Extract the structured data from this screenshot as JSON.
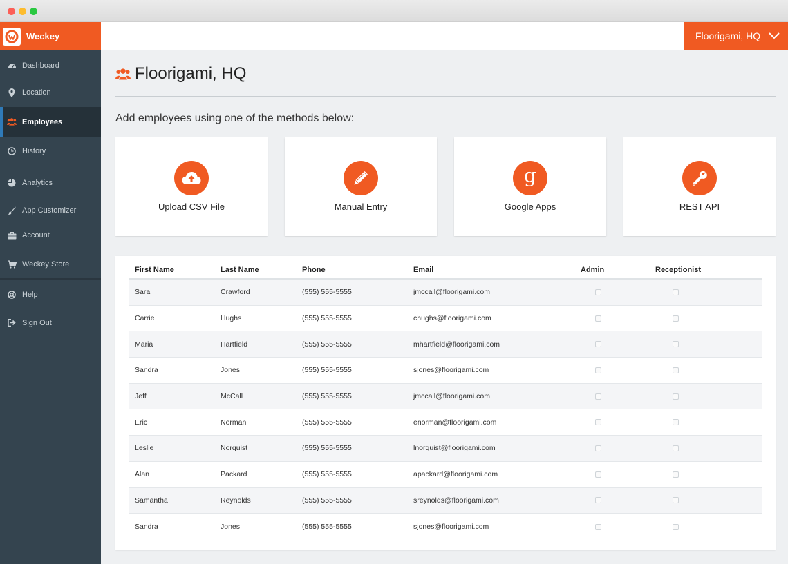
{
  "app": {
    "brand": "Weckey"
  },
  "header": {
    "location": "Floorigami, HQ"
  },
  "sidebar": {
    "items": [
      {
        "label": "Dashboard",
        "icon": "dashboard-icon"
      },
      {
        "label": "Location",
        "icon": "map-pin-icon"
      },
      {
        "label": "Employees",
        "icon": "users-icon",
        "active": true
      },
      {
        "label": "History",
        "icon": "clock-icon"
      },
      {
        "label": "Analytics",
        "icon": "pie-chart-icon"
      },
      {
        "label": "App Customizer",
        "icon": "paintbrush-icon"
      },
      {
        "label": "Account",
        "icon": "briefcase-icon"
      },
      {
        "label": "Weckey Store",
        "icon": "cart-icon"
      },
      {
        "label": "Help",
        "icon": "lifebuoy-icon"
      },
      {
        "label": "Sign Out",
        "icon": "sign-out-icon"
      }
    ]
  },
  "main": {
    "title": "Floorigami, HQ",
    "subtitle": "Add employees using one of the methods below:",
    "methods": [
      {
        "label": "Upload CSV File",
        "icon": "cloud-upload-icon"
      },
      {
        "label": "Manual Entry",
        "icon": "pencil-icon"
      },
      {
        "label": "Google Apps",
        "icon": "google-icon"
      },
      {
        "label": "REST API",
        "icon": "wrench-icon"
      }
    ]
  },
  "table": {
    "headers": {
      "first": "First Name",
      "last": "Last Name",
      "phone": "Phone",
      "email": "Email",
      "admin": "Admin",
      "receptionist": "Receptionist"
    },
    "rows": [
      {
        "first": "Sara",
        "last": "Crawford",
        "phone": "(555) 555-5555",
        "email": "jmccall@floorigami.com",
        "admin": false,
        "receptionist": false
      },
      {
        "first": "Carrie",
        "last": "Hughs",
        "phone": "(555) 555-5555",
        "email": "chughs@floorigami.com",
        "admin": false,
        "receptionist": false
      },
      {
        "first": "Maria",
        "last": "Hartfield",
        "phone": "(555) 555-5555",
        "email": "mhartfield@floorigami.com",
        "admin": false,
        "receptionist": false
      },
      {
        "first": "Sandra",
        "last": "Jones",
        "phone": "(555) 555-5555",
        "email": "sjones@floorigami.com",
        "admin": false,
        "receptionist": false
      },
      {
        "first": "Jeff",
        "last": "McCall",
        "phone": "(555) 555-5555",
        "email": "jmccall@floorigami.com",
        "admin": false,
        "receptionist": false
      },
      {
        "first": "Eric",
        "last": "Norman",
        "phone": "(555) 555-5555",
        "email": "enorman@floorigami.com",
        "admin": false,
        "receptionist": false
      },
      {
        "first": "Leslie",
        "last": "Norquist",
        "phone": "(555) 555-5555",
        "email": "lnorquist@floorigami.com",
        "admin": false,
        "receptionist": false
      },
      {
        "first": "Alan",
        "last": "Packard",
        "phone": "(555) 555-5555",
        "email": "apackard@floorigami.com",
        "admin": false,
        "receptionist": false
      },
      {
        "first": "Samantha",
        "last": "Reynolds",
        "phone": "(555) 555-5555",
        "email": "sreynolds@floorigami.com",
        "admin": false,
        "receptionist": false
      },
      {
        "first": "Sandra",
        "last": "Jones",
        "phone": "(555) 555-5555",
        "email": "sjones@floorigami.com",
        "admin": false,
        "receptionist": false
      }
    ]
  },
  "colors": {
    "accent": "#f05a22",
    "sidebar": "#34444f",
    "sidebar_active": "#253139",
    "active_marker": "#2f7ab8",
    "background": "#eef0f2"
  }
}
